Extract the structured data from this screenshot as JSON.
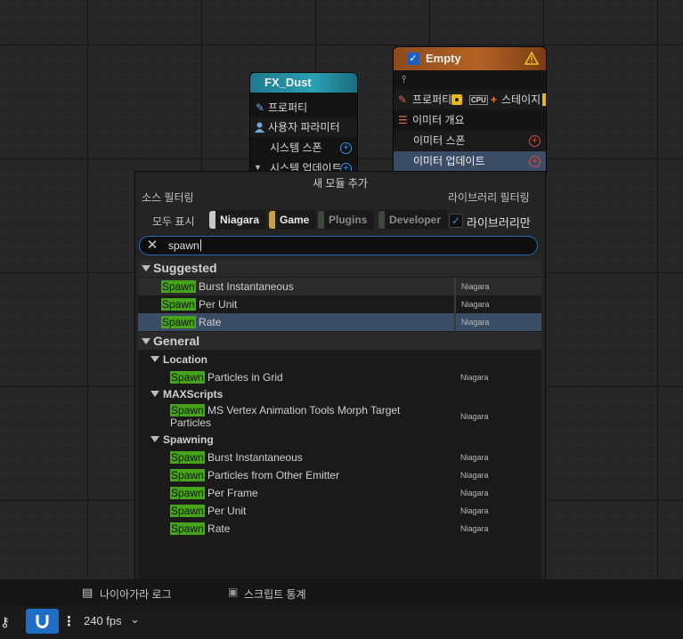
{
  "nodes": {
    "fx_dust": {
      "title": "FX_Dust",
      "rows": [
        "프로퍼티",
        "사용자 파라미터",
        "시스템 스폰",
        "시스템 업데이트"
      ]
    },
    "empty": {
      "title": "Empty",
      "row_properties": "프로퍼티",
      "cpu_badge": "CPU",
      "row_stage": "스테이지",
      "emitter_summary": "이미터 개요",
      "emitter_spawn": "이미터 스폰",
      "emitter_update": "이미터 업데이트"
    }
  },
  "dialog": {
    "title": "새 모듈 추가",
    "source_filter_label": "소스 필터링",
    "library_filter_label": "라이브러리 필터링",
    "show_all": "모두 표시",
    "filters": [
      {
        "label": "Niagara",
        "color": "#c8c8c8"
      },
      {
        "label": "Game",
        "color": "#c6a14a"
      },
      {
        "label": "Plugins",
        "color": "#3c4a3c"
      },
      {
        "label": "Developer",
        "color": "#3c4a3c"
      }
    ],
    "library_only": "라이브러리만",
    "search_value": "spawn",
    "highlight_color": "#46a31a",
    "sections": {
      "suggested": {
        "title": "Suggested",
        "items": [
          {
            "match": "Spawn",
            "rest": " Burst Instantaneous",
            "source": "Niagara"
          },
          {
            "match": "Spawn",
            "rest": " Per Unit",
            "source": "Niagara"
          },
          {
            "match": "Spawn",
            "rest": " Rate",
            "source": "Niagara"
          }
        ]
      },
      "general": {
        "title": "General",
        "location": {
          "title": "Location",
          "items": [
            {
              "match": "Spawn",
              "rest": " Particles in Grid",
              "source": "Niagara"
            }
          ]
        },
        "maxscripts": {
          "title": "MAXScripts",
          "items": [
            {
              "match": "Spawn",
              "rest": " MS Vertex Animation Tools Morph Target",
              "rest2": "Particles",
              "source": "Niagara"
            }
          ]
        },
        "spawning": {
          "title": "Spawning",
          "items": [
            {
              "match": "Spawn",
              "rest": " Burst Instantaneous",
              "source": "Niagara"
            },
            {
              "match": "Spawn",
              "rest": " Particles from Other Emitter",
              "source": "Niagara"
            },
            {
              "match": "Spawn",
              "rest": " Per Frame",
              "source": "Niagara"
            },
            {
              "match": "Spawn",
              "rest": " Per Unit",
              "source": "Niagara"
            },
            {
              "match": "Spawn",
              "rest": " Rate",
              "source": "Niagara"
            }
          ]
        }
      }
    }
  },
  "bottom": {
    "tab1_label": "나이아가라 로그",
    "tab2_label": "스크립트 통계",
    "fps": "240 fps"
  }
}
